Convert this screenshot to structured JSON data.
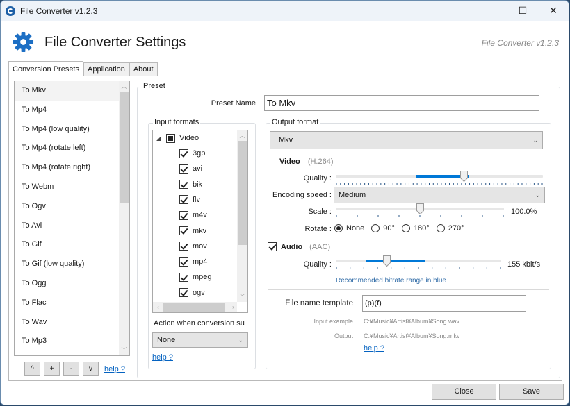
{
  "window": {
    "title": "File Converter v1.2.3",
    "controls": {
      "minimize": "—",
      "maximize": "☐",
      "close": "✕"
    }
  },
  "header": {
    "title": "File Converter Settings",
    "version": "File Converter v1.2.3",
    "icon": "gear-icon"
  },
  "tabs": [
    {
      "label": "Conversion Presets",
      "active": true
    },
    {
      "label": "Application",
      "active": false
    },
    {
      "label": "About",
      "active": false
    }
  ],
  "presets": {
    "items": [
      "To Mkv",
      "To Mp4",
      "To Mp4 (low quality)",
      "To Mp4 (rotate left)",
      "To Mp4 (rotate right)",
      "To Webm",
      "To Ogv",
      "To Avi",
      "To Gif",
      "To Gif (low quality)",
      "To Ogg",
      "To Flac",
      "To Wav",
      "To Mp3"
    ],
    "selected_index": 0,
    "buttons": {
      "up": "^",
      "add": "+",
      "remove": "-",
      "down": "v"
    },
    "help": "help ?"
  },
  "preset": {
    "group_label": "Preset",
    "name_label": "Preset Name",
    "name_value": "To Mkv",
    "input_formats": {
      "label": "Input formats",
      "category": "Video",
      "formats": [
        "3gp",
        "avi",
        "bik",
        "flv",
        "m4v",
        "mkv",
        "mov",
        "mp4",
        "mpeg",
        "ogv"
      ],
      "action_label": "Action when conversion su",
      "action_value": "None",
      "help": "help ?"
    },
    "output": {
      "label": "Output format",
      "format_value": "Mkv",
      "video": {
        "label": "Video",
        "codec": "(H.264)",
        "quality_label": "Quality :",
        "quality_value": 0.62,
        "quality_range": [
          0.39,
          0.64
        ],
        "encoding_label": "Encoding speed :",
        "encoding_value": "Medium",
        "scale_label": "Scale :",
        "scale_value": 0.5,
        "scale_text": "100.0%",
        "rotate_label": "Rotate :",
        "rotate_options": [
          "None",
          "90°",
          "180°",
          "270°"
        ],
        "rotate_selected": 0
      },
      "audio": {
        "label": "Audio",
        "codec": "(AAC)",
        "enabled": true,
        "quality_label": "Quality :",
        "quality_value": 0.31,
        "quality_range": [
          0.18,
          0.54
        ],
        "quality_text": "155 kbit/s",
        "hint": "Recommended bitrate range in blue"
      },
      "filename": {
        "label": "File name template",
        "value": "(p)(f)",
        "input_example_label": "Input example",
        "input_example": "C:¥Music¥Artist¥Album¥Song.wav",
        "output_label": "Output",
        "output_example": "C:¥Music¥Artist¥Album¥Song.mkv",
        "help": "help ?"
      }
    }
  },
  "footer": {
    "close": "Close",
    "save": "Save"
  }
}
